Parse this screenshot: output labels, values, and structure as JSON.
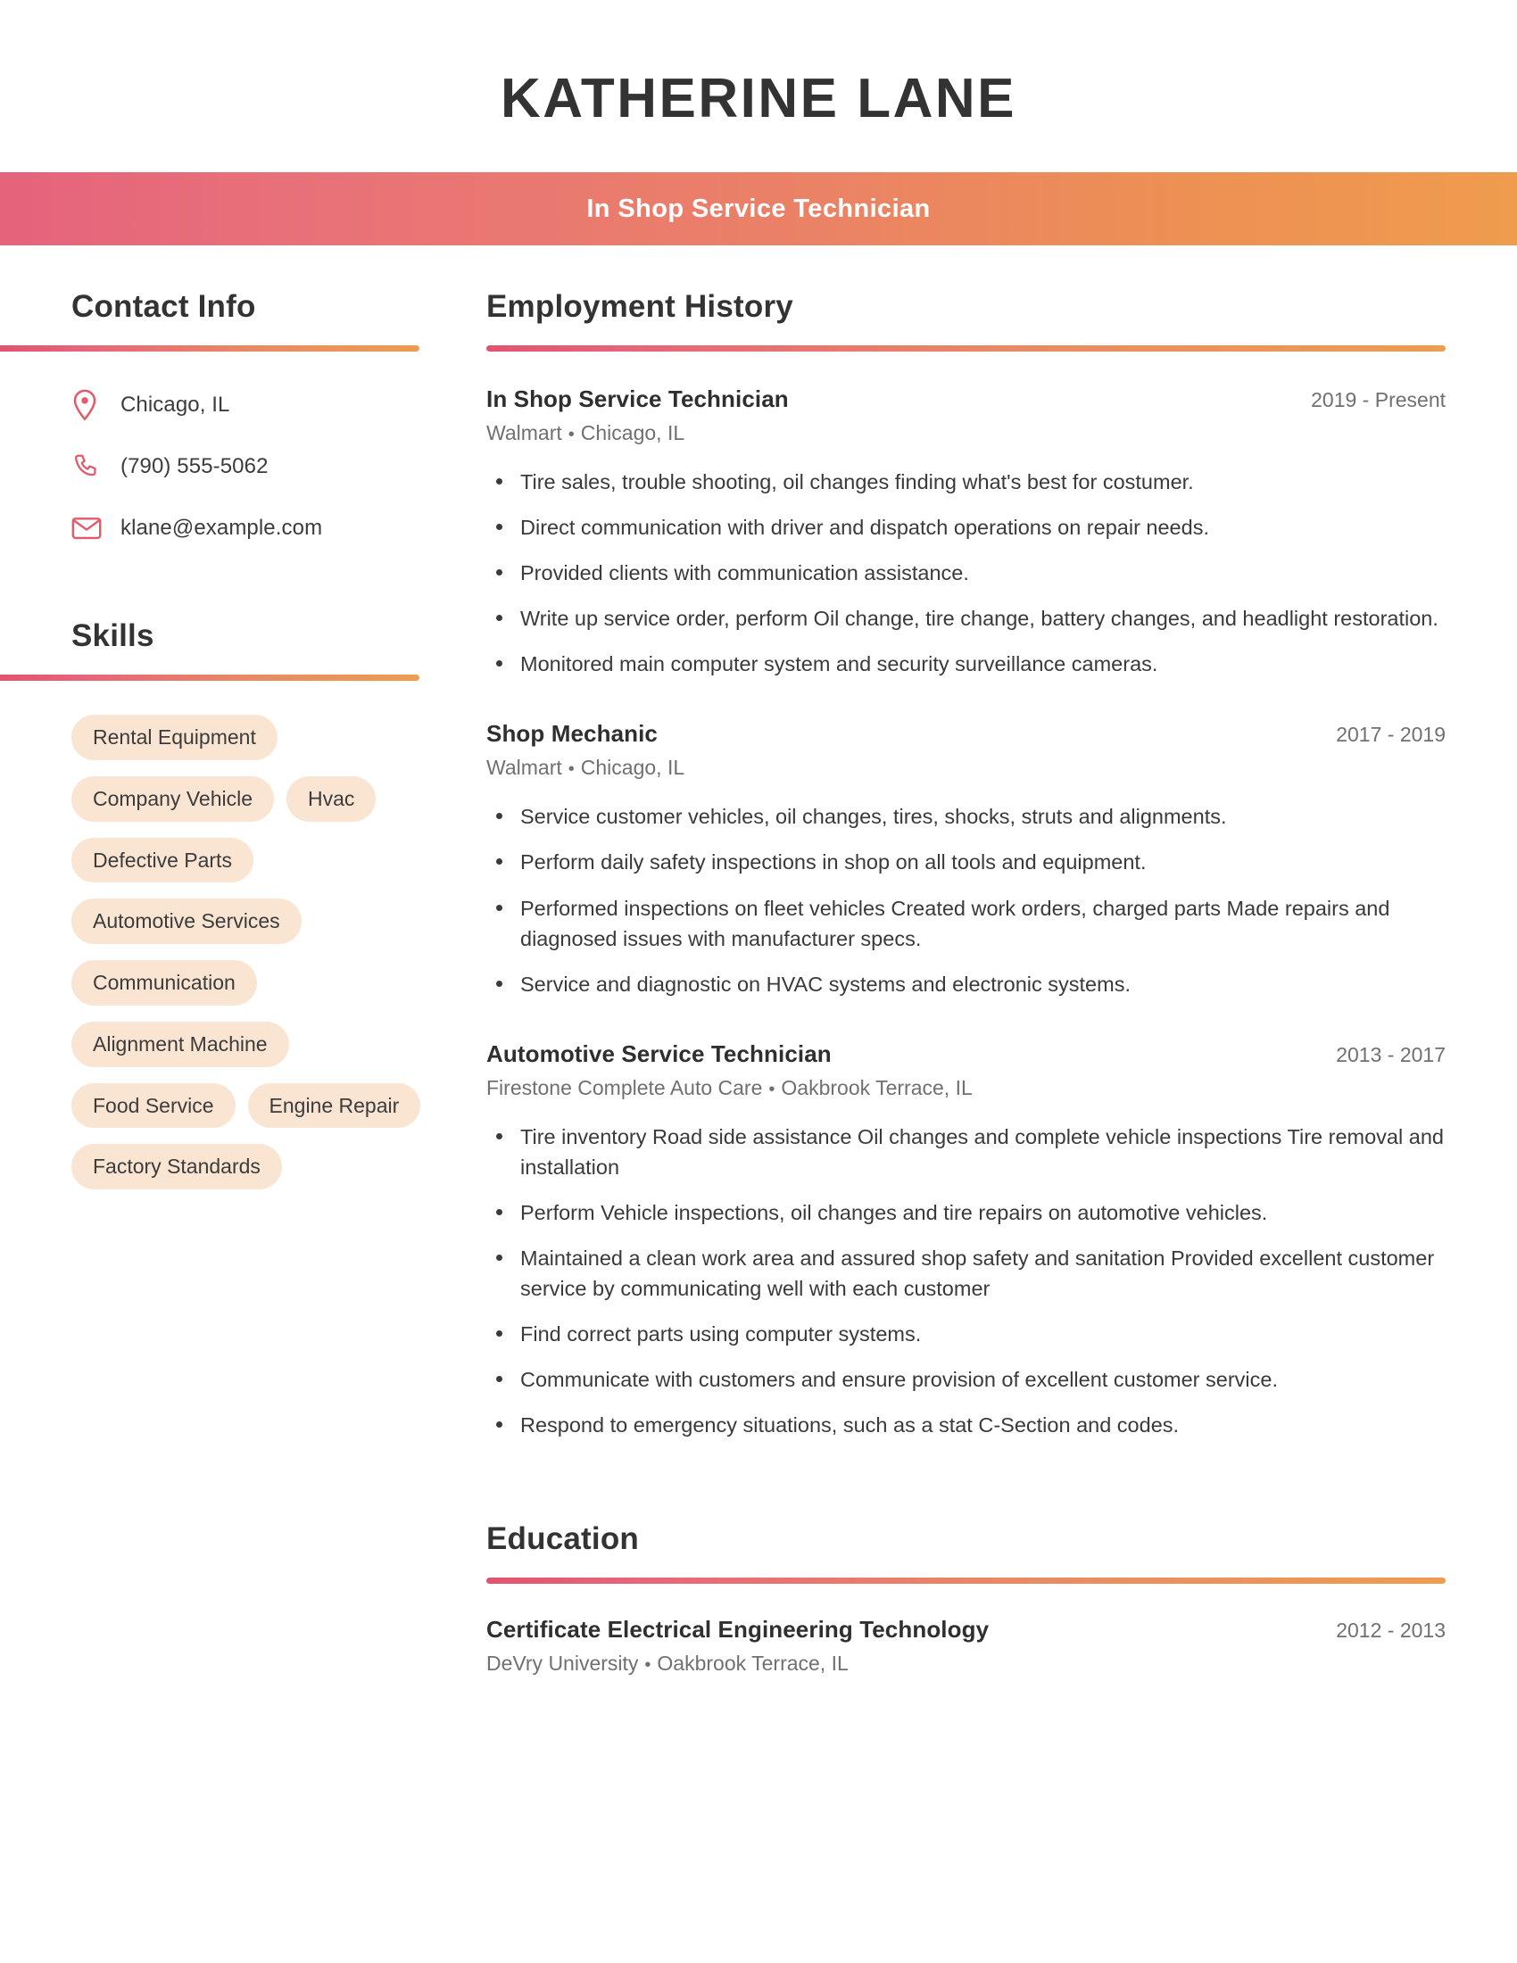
{
  "header": {
    "name": "KATHERINE LANE",
    "job_title": "In Shop Service Technician",
    "gradient_start": "#e5637b",
    "gradient_end": "#ef9c4e"
  },
  "sidebar": {
    "contact": {
      "heading": "Contact Info",
      "items": [
        {
          "icon": "location-pin-icon",
          "value": "Chicago, IL"
        },
        {
          "icon": "phone-icon",
          "value": "(790) 555-5062"
        },
        {
          "icon": "email-icon",
          "value": "klane@example.com"
        }
      ]
    },
    "skills": {
      "heading": "Skills",
      "pill_color": "#fae5d3",
      "items": [
        "Rental Equipment",
        "Company Vehicle",
        "Hvac",
        "Defective Parts",
        "Automotive Services",
        "Communication",
        "Alignment Machine",
        "Food Service",
        "Engine Repair",
        "Factory Standards"
      ]
    }
  },
  "main": {
    "employment": {
      "heading": "Employment History",
      "entries": [
        {
          "title": "In Shop Service Technician",
          "dates": "2019 - Present",
          "company": "Walmart",
          "location": "Chicago, IL",
          "bullets": [
            "Tire sales, trouble shooting, oil changes finding what's best for costumer.",
            "Direct communication with driver and dispatch operations on repair needs.",
            "Provided clients with communication assistance.",
            "Write up service order, perform Oil change, tire change, battery changes, and headlight restoration.",
            "Monitored main computer system and security surveillance cameras."
          ]
        },
        {
          "title": "Shop Mechanic",
          "dates": "2017 - 2019",
          "company": "Walmart",
          "location": "Chicago, IL",
          "bullets": [
            "Service customer vehicles, oil changes, tires, shocks, struts and alignments.",
            "Perform daily safety inspections in shop on all tools and equipment.",
            "Performed inspections on fleet vehicles Created work orders, charged parts Made repairs and diagnosed issues with manufacturer specs.",
            "Service and diagnostic on HVAC systems and electronic systems."
          ]
        },
        {
          "title": "Automotive Service Technician",
          "dates": "2013 - 2017",
          "company": "Firestone Complete Auto Care",
          "location": "Oakbrook Terrace, IL",
          "bullets": [
            "Tire inventory Road side assistance Oil changes and complete vehicle inspections Tire removal and installation",
            "Perform Vehicle inspections, oil changes and tire repairs on automotive vehicles.",
            "Maintained a clean work area and assured shop safety and sanitation Provided excellent customer service by communicating well with each customer",
            "Find correct parts using computer systems.",
            "Communicate with customers and ensure provision of excellent customer service.",
            "Respond to emergency situations, such as a stat C-Section and codes."
          ]
        }
      ]
    },
    "education": {
      "heading": "Education",
      "entries": [
        {
          "title": "Certificate Electrical Engineering Technology",
          "dates": "2012 - 2013",
          "school": "DeVry University",
          "location": "Oakbrook Terrace, IL"
        }
      ]
    }
  }
}
